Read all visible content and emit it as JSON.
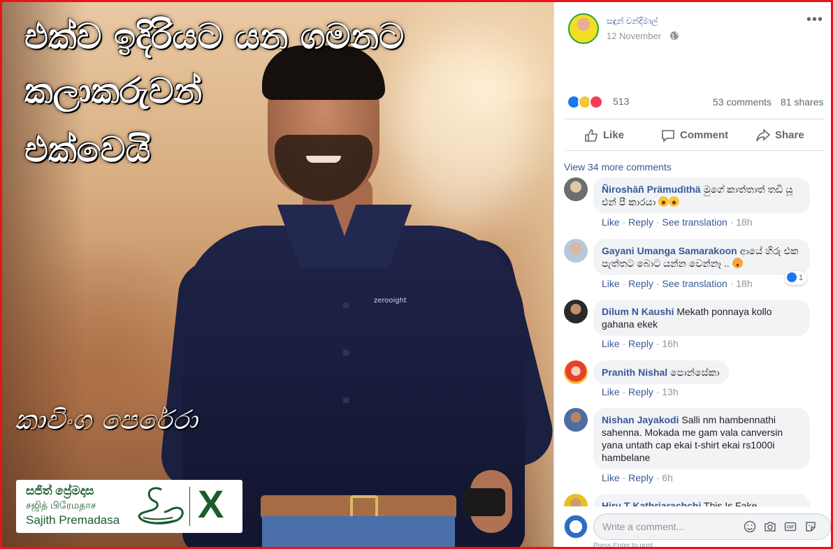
{
  "photo": {
    "headline_line1": "එක්ව ඉදිරියට යන ගමනට",
    "headline_line2": "කලාකරුවන්",
    "headline_line3": "එක්වෙයි",
    "shirt_brand": "zerooight",
    "signature": "කාවිංග පෙරේරා",
    "logo_card": {
      "line1": "සජිත් ප්‍රේමදාස",
      "line2": "சஜித் பிரேமதாச",
      "line3": "Sajith Premadasa",
      "mark": "X"
    }
  },
  "post": {
    "author": "සඳුන් චන්දිමාල්",
    "date": "12 November",
    "more_label": "•••",
    "reaction_count": "513",
    "comments_count": "53 comments",
    "shares_count": "81 shares",
    "actions": {
      "like": "Like",
      "comment": "Comment",
      "share": "Share"
    },
    "view_more": "View 34 more comments"
  },
  "comments": [
    {
      "author": "Ñiroshāñ Prämudìthä",
      "text": "මුගේ කාත්තාත් තඩි යූ එන් පී කාරයා",
      "like": "Like",
      "reply": "Reply",
      "translate": "See translation",
      "time": "18h"
    },
    {
      "author": "Gayani Umanga Samarakoon",
      "text": "ආයේ හිරු එක පැත්තට බොට යන්න වෙන්නෑ ..",
      "like": "Like",
      "reply": "Reply",
      "translate": "See translation",
      "time": "18h",
      "reaction_badge": "1"
    },
    {
      "author": "Dilum N Kaushi",
      "text": "Mekath ponnaya kollo gahana ekek",
      "like": "Like",
      "reply": "Reply",
      "time": "16h"
    },
    {
      "author": "Pranith Nishal",
      "text": "පොන්සේකා",
      "like": "Like",
      "reply": "Reply",
      "time": "13h"
    },
    {
      "author": "Nishan Jayakodi",
      "text": "Salli nm hambennathi sahenna. Mokada me gam vala canversin yana untath cap ekai t-shirt ekai rs1000i hambelane",
      "like": "Like",
      "reply": "Reply",
      "time": "6h"
    },
    {
      "author": "Hiru T Kathriarachchi",
      "text": "This Is Fake"
    }
  ],
  "composer": {
    "placeholder": "Write a comment...",
    "hint": "Press Enter to post.",
    "gif_label": "GIF"
  },
  "colors": {
    "frame_border": "#e8141b",
    "link_blue": "#385898",
    "logo_green": "#1a5c2e"
  }
}
